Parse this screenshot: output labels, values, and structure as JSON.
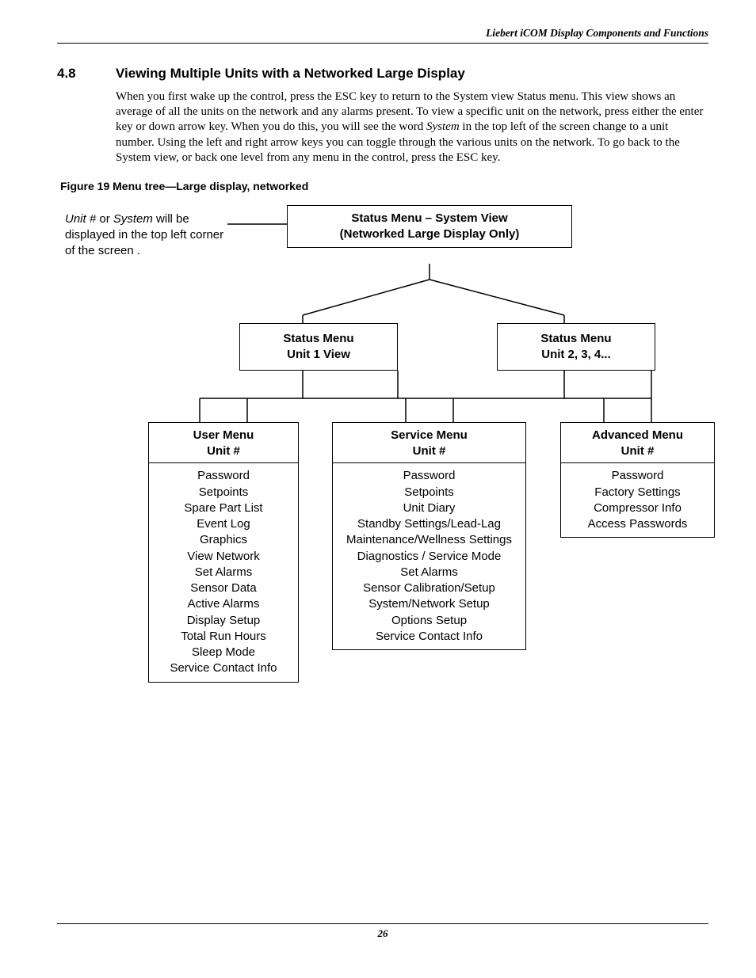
{
  "header": "Liebert iCOM Display Components and Functions",
  "section": {
    "number": "4.8",
    "title": "Viewing Multiple Units with a Networked Large Display"
  },
  "para": {
    "pre": "When you first wake up the control, press the ESC key to return to the System view Status menu. This view shows an average of all the units on the network and any alarms present. To view a specific unit on the network, press either the enter key or down arrow key. When you do this, you will see the word ",
    "italic": "System",
    "post": " in the top left of the screen change to a unit number. Using the left and right arrow keys you can toggle through the various units on the network. To go back to the System view, or back one level from any menu in the control, press the ESC key."
  },
  "figure": "Figure 19  Menu tree—Large display, networked",
  "note": {
    "pre_it": "Unit #",
    "mid": " or ",
    "mid_it": "System",
    "post": " will be displayed in the top left corner of the screen ."
  },
  "top_box": {
    "l1": "Status Menu – System View",
    "l2": "(Networked Large Display Only)"
  },
  "unit1": {
    "l1": "Status Menu",
    "l2": "Unit 1 View"
  },
  "unit234": {
    "l1": "Status Menu",
    "l2": "Unit 2, 3, 4..."
  },
  "user": {
    "hdr1": "User Menu",
    "hdr2": "Unit #",
    "items": [
      "Password",
      "Setpoints",
      "Spare Part List",
      "Event Log",
      "Graphics",
      "View Network",
      "Set Alarms",
      "Sensor Data",
      "Active Alarms",
      "Display Setup",
      "Total Run Hours",
      "Sleep Mode",
      "Service Contact Info"
    ]
  },
  "service": {
    "hdr1": "Service Menu",
    "hdr2": "Unit #",
    "items": [
      "Password",
      "Setpoints",
      "Unit Diary",
      "Standby Settings/Lead-Lag",
      "Maintenance/Wellness Settings",
      "Diagnostics / Service Mode",
      "Set Alarms",
      "Sensor Calibration/Setup",
      "System/Network Setup",
      "Options Setup",
      "Service Contact Info"
    ]
  },
  "advanced": {
    "hdr1": "Advanced Menu",
    "hdr2": "Unit #",
    "items": [
      "Password",
      "Factory Settings",
      "Compressor Info",
      "Access Passwords"
    ]
  },
  "page_number": "26"
}
